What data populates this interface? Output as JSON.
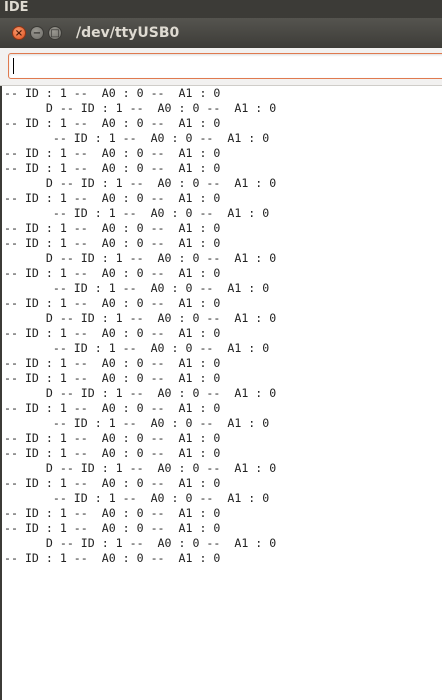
{
  "app_bar": {
    "title": "IDE"
  },
  "window": {
    "title": "/dev/ttyUSB0",
    "close_glyph": "×",
    "minimize_glyph": "−",
    "maximize_glyph": "□"
  },
  "send_input": {
    "value": "",
    "placeholder": ""
  },
  "serial_output": {
    "lines": [
      "-- ID : 1 --  A0 : 0 --  A1 : 0",
      "      D -- ID : 1 --  A0 : 0 --  A1 : 0",
      "-- ID : 1 --  A0 : 0 --  A1 : 0",
      "       -- ID : 1 --  A0 : 0 --  A1 : 0",
      "-- ID : 1 --  A0 : 0 --  A1 : 0",
      "-- ID : 1 --  A0 : 0 --  A1 : 0",
      "      D -- ID : 1 --  A0 : 0 --  A1 : 0",
      "-- ID : 1 --  A0 : 0 --  A1 : 0",
      "       -- ID : 1 --  A0 : 0 --  A1 : 0",
      "-- ID : 1 --  A0 : 0 --  A1 : 0",
      "-- ID : 1 --  A0 : 0 --  A1 : 0",
      "      D -- ID : 1 --  A0 : 0 --  A1 : 0",
      "-- ID : 1 --  A0 : 0 --  A1 : 0",
      "       -- ID : 1 --  A0 : 0 --  A1 : 0",
      "-- ID : 1 --  A0 : 0 --  A1 : 0",
      "      D -- ID : 1 --  A0 : 0 --  A1 : 0",
      "-- ID : 1 --  A0 : 0 --  A1 : 0",
      "       -- ID : 1 --  A0 : 0 --  A1 : 0",
      "-- ID : 1 --  A0 : 0 --  A1 : 0",
      "-- ID : 1 --  A0 : 0 --  A1 : 0",
      "      D -- ID : 1 --  A0 : 0 --  A1 : 0",
      "-- ID : 1 --  A0 : 0 --  A1 : 0",
      "       -- ID : 1 --  A0 : 0 --  A1 : 0",
      "-- ID : 1 --  A0 : 0 --  A1 : 0",
      "-- ID : 1 --  A0 : 0 --  A1 : 0",
      "      D -- ID : 1 --  A0 : 0 --  A1 : 0",
      "-- ID : 1 --  A0 : 0 --  A1 : 0",
      "       -- ID : 1 --  A0 : 0 --  A1 : 0",
      "-- ID : 1 --  A0 : 0 --  A1 : 0",
      "-- ID : 1 --  A0 : 0 --  A1 : 0",
      "      D -- ID : 1 --  A0 : 0 --  A1 : 0",
      "-- ID : 1 --  A0 : 0 --  A1 : 0"
    ]
  }
}
